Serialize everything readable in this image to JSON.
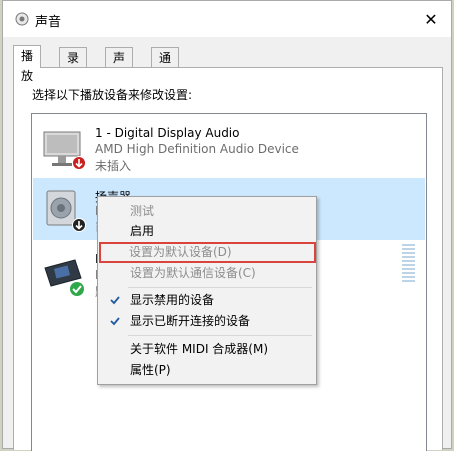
{
  "window": {
    "title": "声音"
  },
  "tabs": [
    "播放",
    "录制",
    "声音",
    "通信"
  ],
  "instruction": "选择以下播放设备来修改设置:",
  "devices": [
    {
      "name": "1 - Digital Display Audio",
      "description": "AMD High Definition Audio Device",
      "status": "未插入"
    },
    {
      "name": "扬声器",
      "description": "R",
      "status": "已"
    },
    {
      "name": "R",
      "description": "R",
      "status": "默"
    }
  ],
  "context_menu": {
    "items": [
      {
        "label": "测试",
        "enabled": false,
        "checked": false
      },
      {
        "label": "启用",
        "enabled": true,
        "checked": false
      },
      {
        "label": "设置为默认设备(D)",
        "enabled": false,
        "checked": false,
        "highlighted": true
      },
      {
        "label": "设置为默认通信设备(C)",
        "enabled": false,
        "checked": false
      },
      {
        "label": "显示禁用的设备",
        "enabled": true,
        "checked": true
      },
      {
        "label": "显示已断开连接的设备",
        "enabled": true,
        "checked": true
      },
      {
        "label": "关于软件 MIDI 合成器(M)",
        "enabled": true,
        "checked": false
      },
      {
        "label": "属性(P)",
        "enabled": true,
        "checked": false
      }
    ]
  },
  "colors": {
    "selection": "#cce8ff",
    "highlight_border": "#d9443d",
    "check": "#1e5a9e",
    "default_badge": "#2ea84a",
    "disconnected_badge": "#c8201e"
  }
}
